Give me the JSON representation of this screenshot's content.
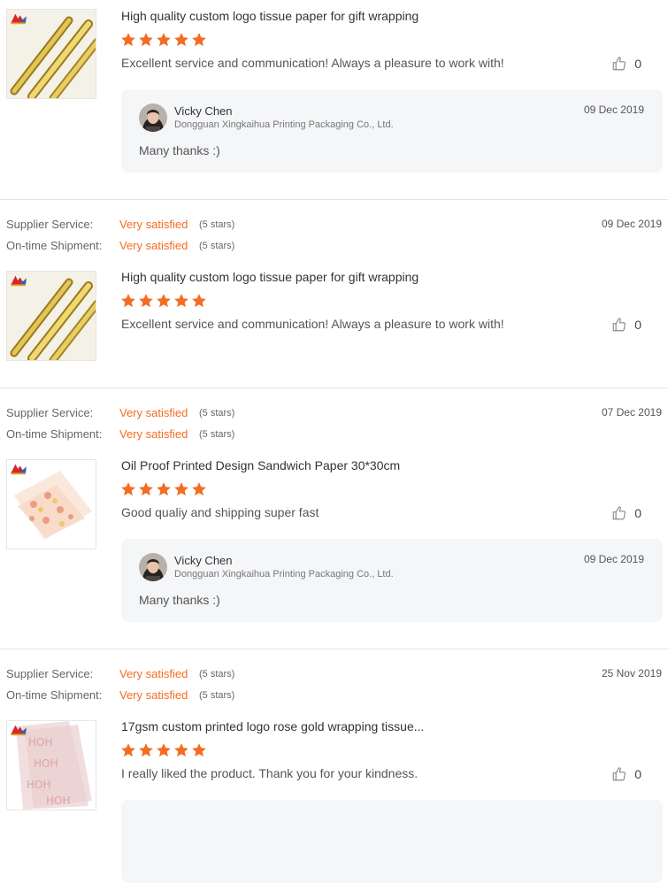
{
  "colors": {
    "accent": "#f36c21",
    "reply_bg": "#f5f6f8",
    "divider": "#e5e5e5"
  },
  "icons": {
    "star": "star-icon",
    "like": "thumbs-up-icon"
  },
  "reviews": [
    {
      "product_title": "High quality custom logo tissue paper for gift wrapping",
      "star_rating": 5,
      "comment": "Excellent service and communication!  Always a pleasure to work with!",
      "likes": "0",
      "reply": {
        "name": "Vicky Chen",
        "company": "Dongguan Xingkaihua Printing Packaging Co., Ltd.",
        "date": "09 Dec 2019",
        "text": "Many thanks :)"
      }
    },
    {
      "ratings": [
        {
          "label": "Supplier Service:",
          "value": "Very satisfied",
          "stars": "(5 stars)"
        },
        {
          "label": "On-time Shipment:",
          "value": "Very satisfied",
          "stars": "(5 stars)"
        }
      ],
      "date": "09 Dec 2019",
      "product_title": "High quality custom logo tissue paper for gift wrapping",
      "star_rating": 5,
      "comment": "Excellent service and communication!  Always a pleasure to work with!",
      "likes": "0"
    },
    {
      "ratings": [
        {
          "label": "Supplier Service:",
          "value": "Very satisfied",
          "stars": "(5 stars)"
        },
        {
          "label": "On-time Shipment:",
          "value": "Very satisfied",
          "stars": "(5 stars)"
        }
      ],
      "date": "07 Dec 2019",
      "product_title": "Oil Proof Printed Design Sandwich Paper 30*30cm",
      "star_rating": 5,
      "comment": "Good qualiy and shipping super fast",
      "likes": "0",
      "reply": {
        "name": "Vicky Chen",
        "company": "Dongguan Xingkaihua Printing Packaging Co., Ltd.",
        "date": "09 Dec 2019",
        "text": "Many thanks :)"
      }
    },
    {
      "ratings": [
        {
          "label": "Supplier Service:",
          "value": "Very satisfied",
          "stars": "(5 stars)"
        },
        {
          "label": "On-time Shipment:",
          "value": "Very satisfied",
          "stars": "(5 stars)"
        }
      ],
      "date": "25 Nov 2019",
      "product_title": "17gsm custom printed logo rose gold wrapping tissue...",
      "star_rating": 5,
      "comment": "I really liked the product.  Thank you for your kindness.",
      "likes": "0"
    }
  ]
}
